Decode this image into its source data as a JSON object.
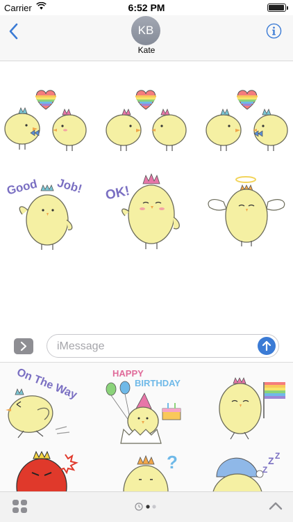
{
  "status_bar": {
    "carrier": "Carrier",
    "time": "6:52 PM",
    "battery_level": 0.9
  },
  "header": {
    "contact_initials": "KB",
    "contact_name": "Kate"
  },
  "input": {
    "placeholder": "iMessage"
  },
  "conversation_stickers": {
    "good_job": {
      "word1": "Good",
      "word2": "Job!"
    },
    "ok": {
      "text": "OK!"
    }
  },
  "drawer_stickers": {
    "on_the_way": {
      "text": "On The Way"
    },
    "happy_birthday": {
      "line1": "HAPPY",
      "line2": "BIRTHDAY"
    }
  },
  "bottom_bar": {
    "page_count": 2,
    "current_page": 1
  },
  "colors": {
    "accent": "#3b7bd5",
    "chick": "#f5f0a3",
    "chick_outline": "#6b6b5a"
  }
}
